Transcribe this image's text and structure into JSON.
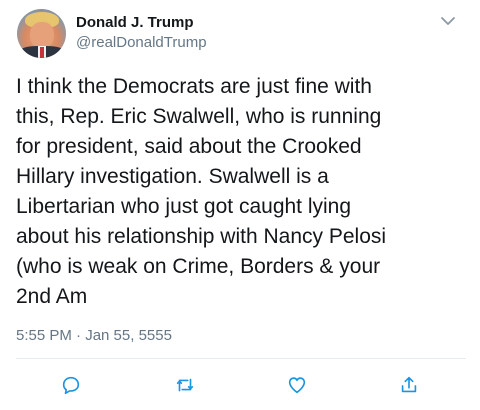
{
  "tweet": {
    "author": {
      "display_name": "Donald J. Trump",
      "handle": "@realDonaldTrump"
    },
    "text": "I think the Democrats are just fine with\nthis, Rep. Eric Swalwell, who is running\nfor president, said about the Crooked\nHillary investigation. Swalwell is a\nLibertarian who just got caught lying\nabout his relationship with Nancy Pelosi\n(who is weak on Crime, Borders & your\n2nd Am",
    "timestamp": "5:55 PM · Jan 55, 5555"
  },
  "icons": {
    "more": "chevron-down-icon",
    "reply": "reply-icon",
    "retweet": "retweet-icon",
    "like": "heart-icon",
    "share": "share-icon"
  },
  "colors": {
    "text": "#14171a",
    "secondary": "#657786",
    "divider": "#e6ecf0",
    "icon": "#1b95e0"
  }
}
